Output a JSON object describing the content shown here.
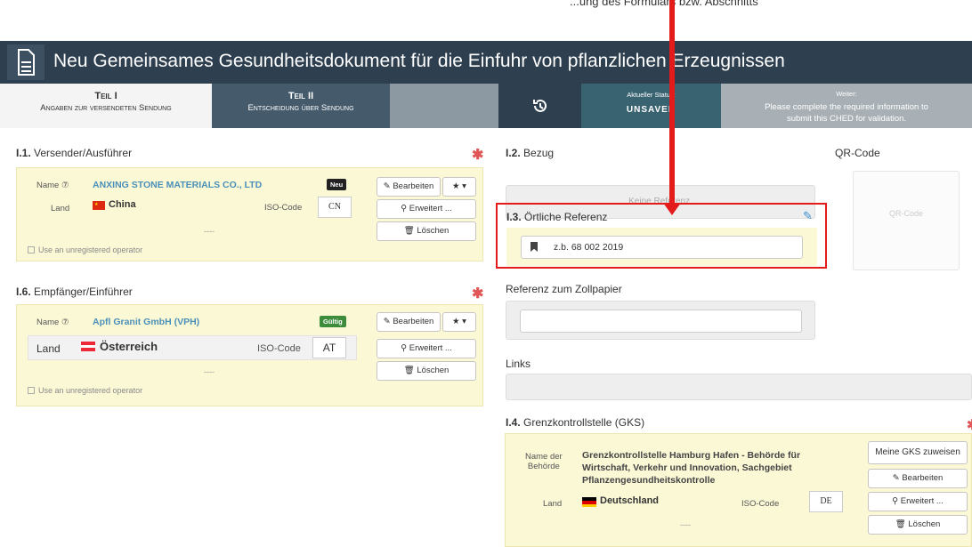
{
  "top_partial_text": "...ung des Formulars bzw. Abschnitts",
  "header": {
    "title": "Neu Gemeinsames Gesundheitsdokument für die Einfuhr von pflanzlichen Erzeugnissen"
  },
  "tabs": {
    "teil1": {
      "title": "Teil I",
      "subtitle": "Angaben zur versendeten Sendung"
    },
    "teil2": {
      "title": "Teil II",
      "subtitle": "Entscheidung über Sendung"
    },
    "status": {
      "label": "Aktueller Status:",
      "value": "UNSAVED"
    },
    "next": {
      "label": "Weiter:",
      "line1": "Please complete the required information to",
      "line2": "submit this CHED for validation."
    }
  },
  "consignor": {
    "heading_num": "I.1.",
    "heading": "Versender/Ausführer",
    "name_label": "Name",
    "name": "ANXING STONE MATERIALS CO., LTD",
    "badge": "Neu",
    "country_label": "Land",
    "country": "China",
    "iso_label": "ISO-Code",
    "iso": "CN",
    "dashes": "----",
    "unregistered": "Use an unregistered operator",
    "btn_edit": "Bearbeiten",
    "btn_advanced": "Erweitert ...",
    "btn_delete": "Löschen"
  },
  "consignee": {
    "heading_num": "I.6.",
    "heading": "Empfänger/Einführer",
    "name_label": "Name",
    "name": "Apfl Granit GmbH (VPH)",
    "badge": "Gültig",
    "country_label": "Land",
    "country": "Österreich",
    "iso_label": "ISO-Code",
    "iso": "AT",
    "dashes": "----",
    "unregistered": "Use an unregistered operator",
    "btn_edit": "Bearbeiten",
    "btn_advanced": "Erweitert ...",
    "btn_delete": "Löschen"
  },
  "reference": {
    "heading_num": "I.2.",
    "heading": "Bezug",
    "empty": "Keine Referenz."
  },
  "qr": {
    "heading": "QR-Code",
    "placeholder": "QR-Code"
  },
  "local_ref": {
    "heading_num": "I.3.",
    "heading": "Örtliche Referenz",
    "value": "z.b. 68 002 2019"
  },
  "customs": {
    "heading": "Referenz zum Zollpapier",
    "value": ""
  },
  "links": {
    "heading": "Links"
  },
  "bip": {
    "heading_num": "I.4.",
    "heading": "Grenzkontrollstelle (GKS)",
    "authority_label_1": "Name der",
    "authority_label_2": "Behörde",
    "authority_1": "Grenzkontrollstelle Hamburg Hafen - Behörde für",
    "authority_2": "Wirtschaft, Verkehr und Innovation, Sachgebiet",
    "authority_3": "Pflanzengesundheitskontrolle",
    "country_label": "Land",
    "country": "Deutschland",
    "iso_label": "ISO-Code",
    "iso": "DE",
    "dashes": "----",
    "btn_assign": "Meine GKS zuweisen",
    "btn_edit": "Bearbeiten",
    "btn_advanced": "Erweitert ...",
    "btn_delete": "Löschen"
  },
  "colors": {
    "highlight": "#e31b1b",
    "header_bg": "#2e3f4f",
    "link": "#4a90b8",
    "required": "#e05555",
    "panel_yellow": "#fbf8d6"
  }
}
